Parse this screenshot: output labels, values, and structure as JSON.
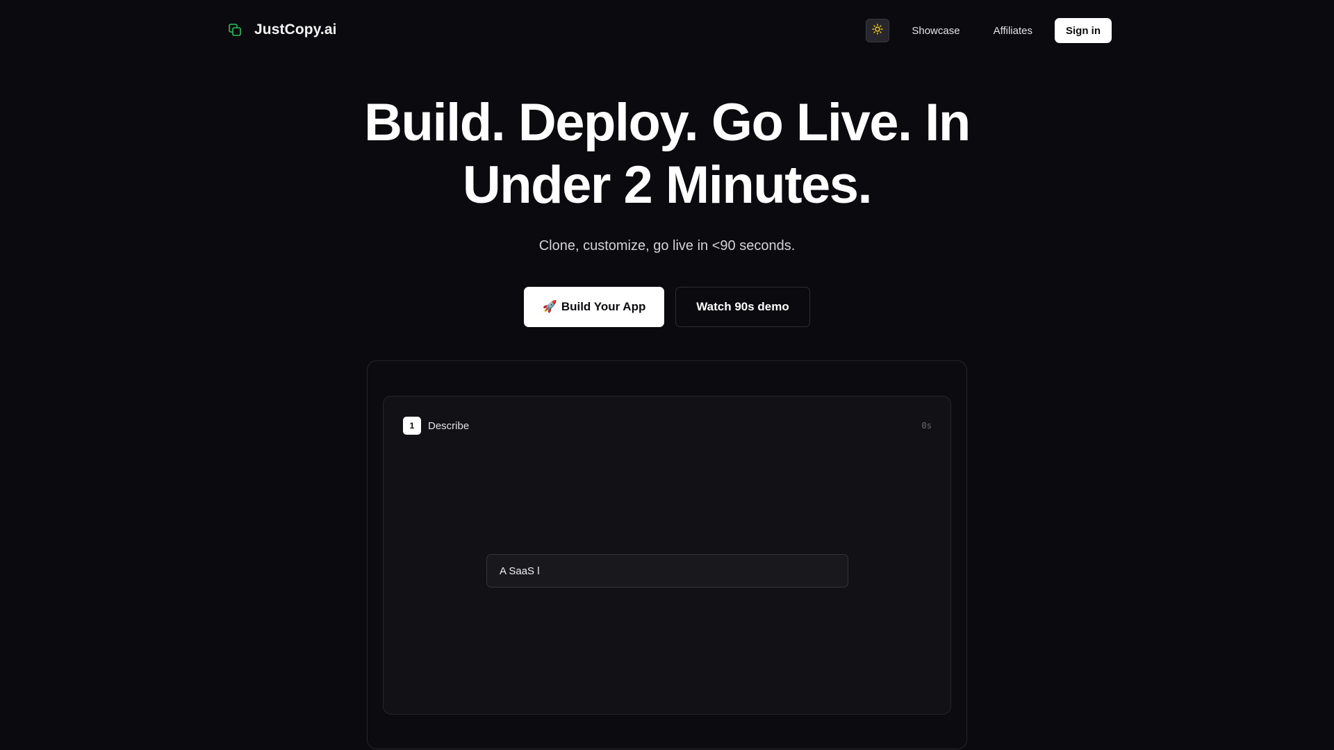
{
  "header": {
    "brand_name": "JustCopy.ai",
    "nav": {
      "showcase": "Showcase",
      "affiliates": "Affiliates",
      "sign_in": "Sign in"
    }
  },
  "hero": {
    "title_line1": "Build. Deploy. Go Live. In",
    "title_line2": "Under 2 Minutes.",
    "subtitle": "Clone, customize, go live in <90 seconds.",
    "primary_button_emoji": "🚀",
    "primary_button_label": "Build Your App",
    "secondary_button_label": "Watch 90s demo"
  },
  "demo": {
    "step_number": "1",
    "step_label": "Describe",
    "timer": "0s",
    "prompt_text": "A SaaS l"
  },
  "colors": {
    "background": "#0b0b0f",
    "brand_icon": "#22c55e",
    "theme_icon": "#facc15",
    "primary_button_bg": "#ffffff"
  },
  "icons": {
    "brand": "copy-icon",
    "theme_toggle": "sun-icon"
  }
}
